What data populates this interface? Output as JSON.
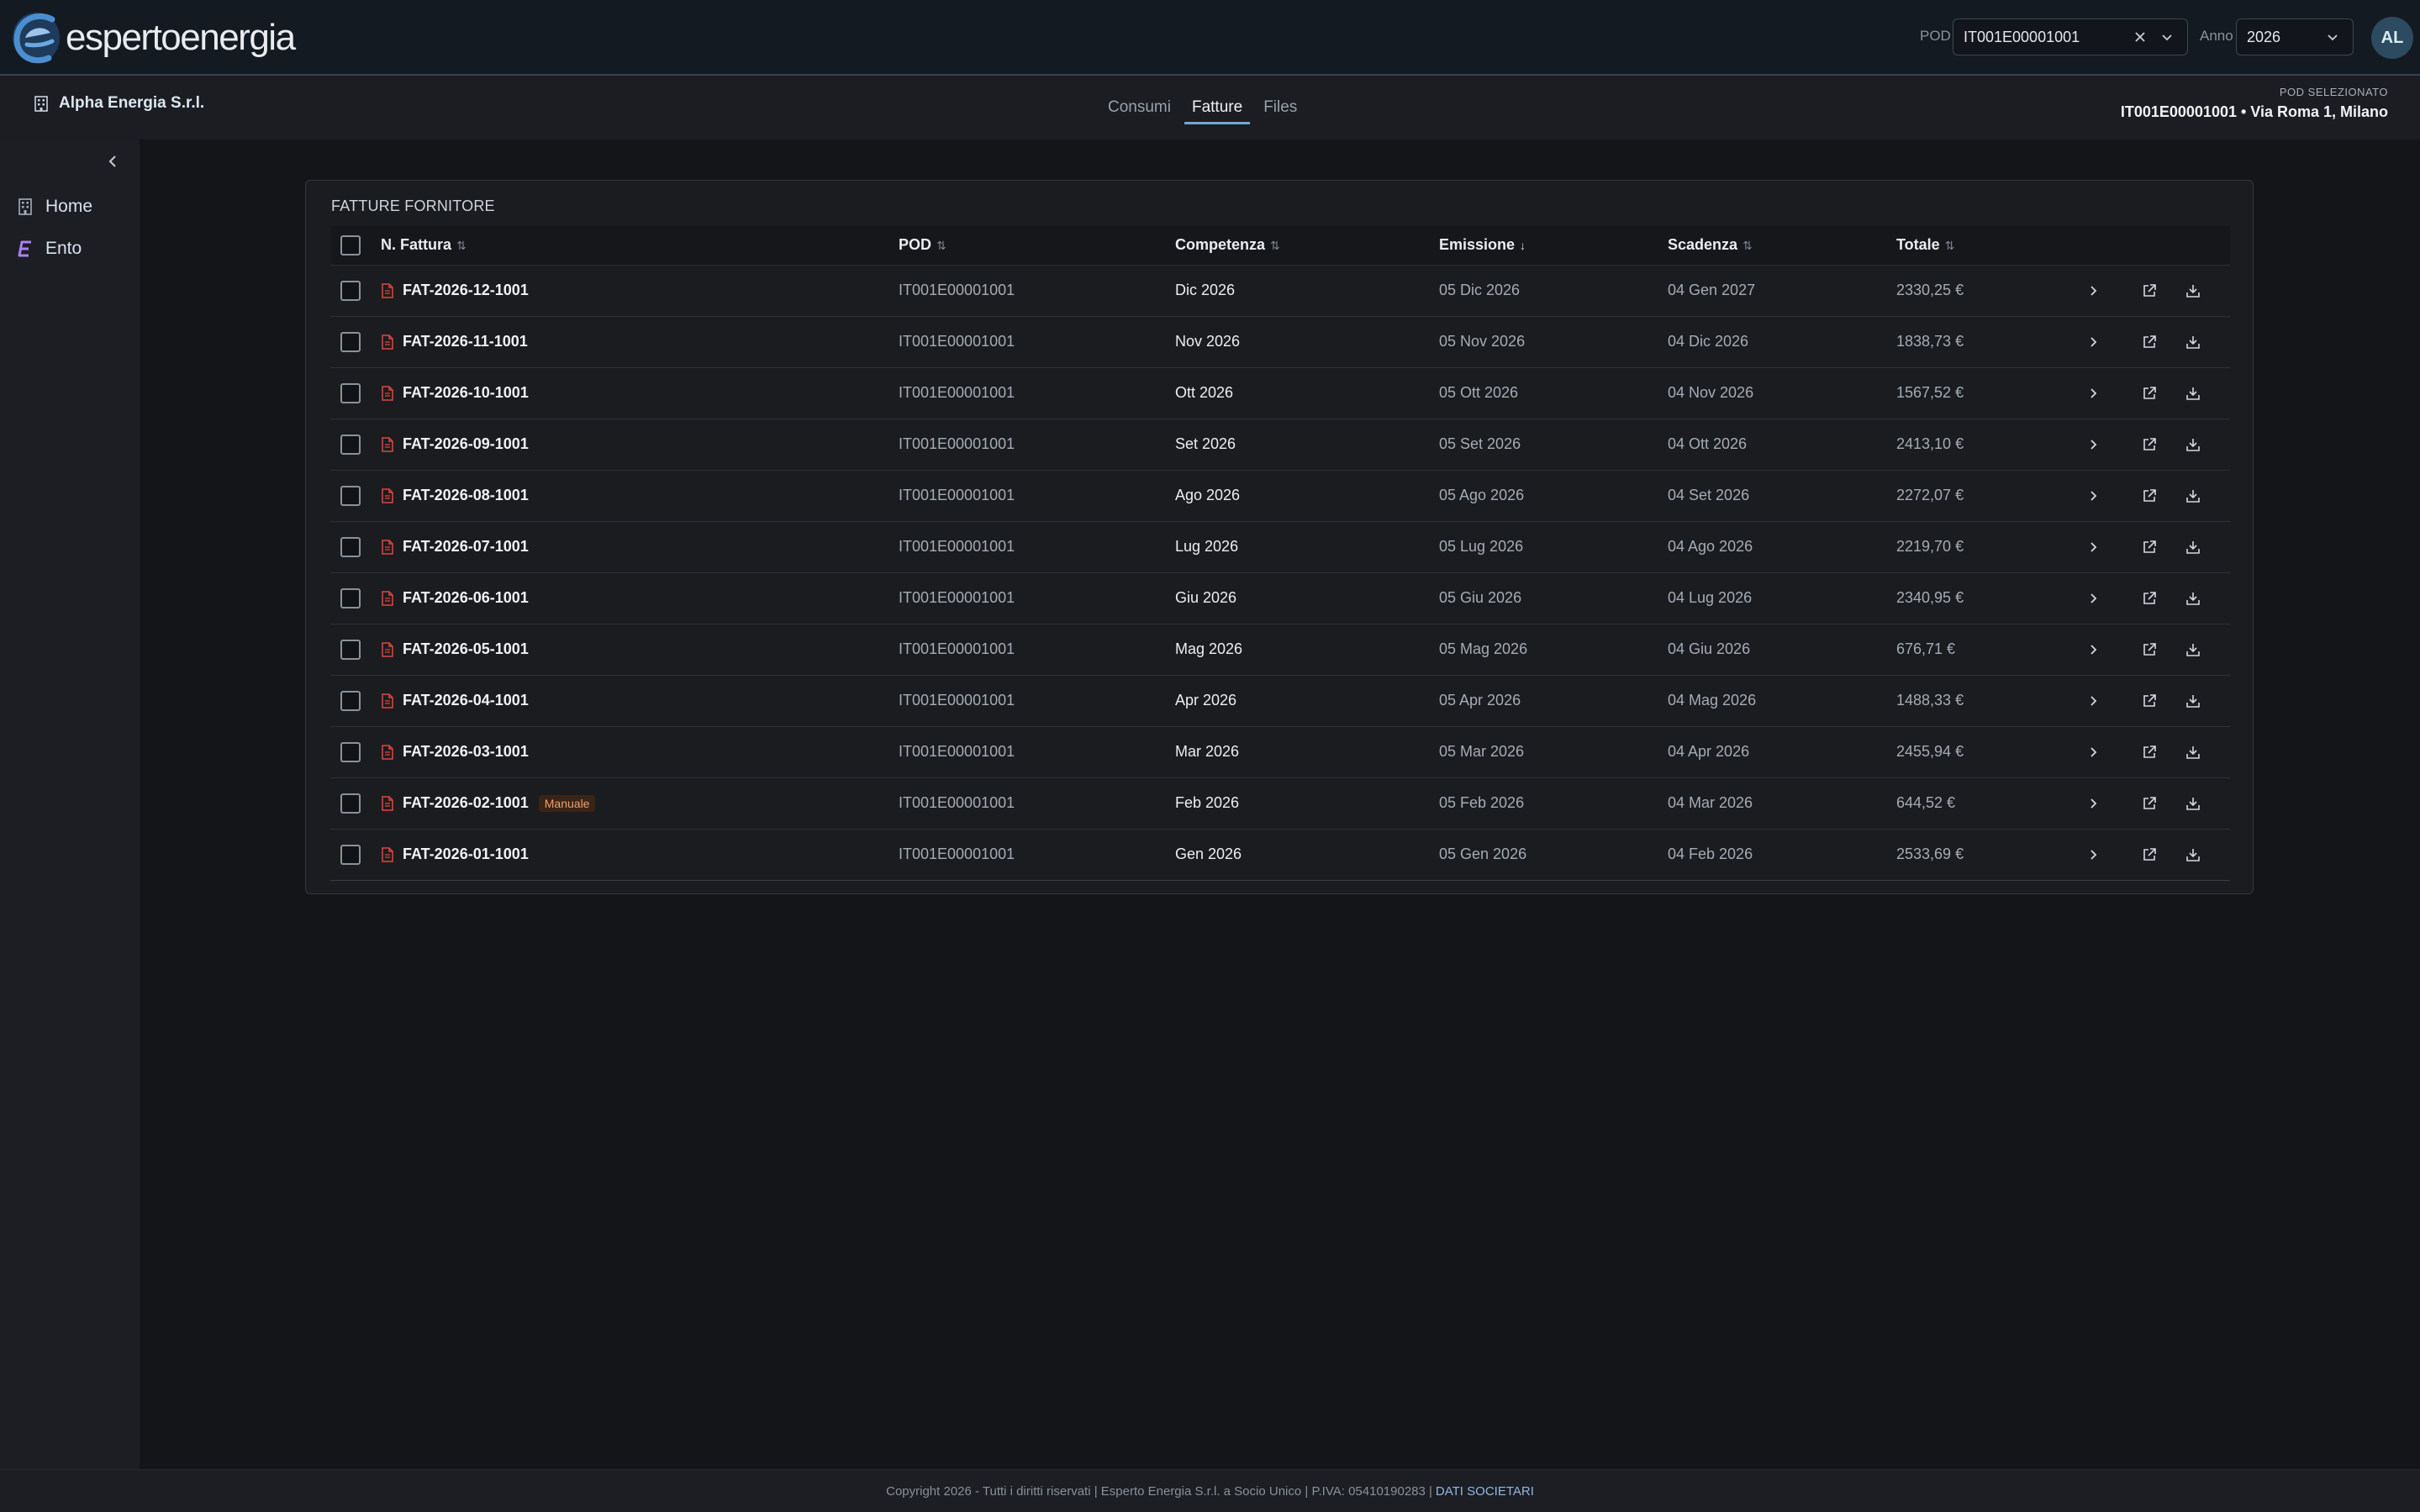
{
  "header": {
    "brand": "espertoenergia",
    "pod_label": "POD",
    "pod_value": "IT001E00001001",
    "year_label": "Anno",
    "year_value": "2026",
    "avatar_initials": "AL"
  },
  "subheader": {
    "company": "Alpha Energia S.r.l.",
    "tabs": [
      {
        "label": "Consumi",
        "active": false
      },
      {
        "label": "Fatture",
        "active": true
      },
      {
        "label": "Files",
        "active": false
      }
    ],
    "pod_selected_label": "POD SELEZIONATO",
    "pod_selected_value": "IT001E00001001 • Via Roma 1, Milano"
  },
  "sidebar": {
    "items": [
      {
        "label": "Home",
        "icon": "building-icon"
      },
      {
        "label": "Ento",
        "icon": "e-logo-icon"
      }
    ]
  },
  "card": {
    "title": "FATTURE FORNITORE",
    "columns": [
      {
        "label": "N. Fattura",
        "sort": "both"
      },
      {
        "label": "POD",
        "sort": "both"
      },
      {
        "label": "Competenza",
        "sort": "both"
      },
      {
        "label": "Emissione",
        "sort": "desc"
      },
      {
        "label": "Scadenza",
        "sort": "both"
      },
      {
        "label": "Totale",
        "sort": "both"
      }
    ],
    "rows": [
      {
        "n": "FAT-2026-12-1001",
        "badge": "",
        "pod": "IT001E00001001",
        "competenza": "Dic 2026",
        "emissione": "05 Dic 2026",
        "scadenza": "04 Gen 2027",
        "totale": "2330,25 €"
      },
      {
        "n": "FAT-2026-11-1001",
        "badge": "",
        "pod": "IT001E00001001",
        "competenza": "Nov 2026",
        "emissione": "05 Nov 2026",
        "scadenza": "04 Dic 2026",
        "totale": "1838,73 €"
      },
      {
        "n": "FAT-2026-10-1001",
        "badge": "",
        "pod": "IT001E00001001",
        "competenza": "Ott 2026",
        "emissione": "05 Ott 2026",
        "scadenza": "04 Nov 2026",
        "totale": "1567,52 €"
      },
      {
        "n": "FAT-2026-09-1001",
        "badge": "",
        "pod": "IT001E00001001",
        "competenza": "Set 2026",
        "emissione": "05 Set 2026",
        "scadenza": "04 Ott 2026",
        "totale": "2413,10 €"
      },
      {
        "n": "FAT-2026-08-1001",
        "badge": "",
        "pod": "IT001E00001001",
        "competenza": "Ago 2026",
        "emissione": "05 Ago 2026",
        "scadenza": "04 Set 2026",
        "totale": "2272,07 €"
      },
      {
        "n": "FAT-2026-07-1001",
        "badge": "",
        "pod": "IT001E00001001",
        "competenza": "Lug 2026",
        "emissione": "05 Lug 2026",
        "scadenza": "04 Ago 2026",
        "totale": "2219,70 €"
      },
      {
        "n": "FAT-2026-06-1001",
        "badge": "",
        "pod": "IT001E00001001",
        "competenza": "Giu 2026",
        "emissione": "05 Giu 2026",
        "scadenza": "04 Lug 2026",
        "totale": "2340,95 €"
      },
      {
        "n": "FAT-2026-05-1001",
        "badge": "",
        "pod": "IT001E00001001",
        "competenza": "Mag 2026",
        "emissione": "05 Mag 2026",
        "scadenza": "04 Giu 2026",
        "totale": "676,71 €"
      },
      {
        "n": "FAT-2026-04-1001",
        "badge": "",
        "pod": "IT001E00001001",
        "competenza": "Apr 2026",
        "emissione": "05 Apr 2026",
        "scadenza": "04 Mag 2026",
        "totale": "1488,33 €"
      },
      {
        "n": "FAT-2026-03-1001",
        "badge": "",
        "pod": "IT001E00001001",
        "competenza": "Mar 2026",
        "emissione": "05 Mar 2026",
        "scadenza": "04 Apr 2026",
        "totale": "2455,94 €"
      },
      {
        "n": "FAT-2026-02-1001",
        "badge": "Manuale",
        "pod": "IT001E00001001",
        "competenza": "Feb 2026",
        "emissione": "05 Feb 2026",
        "scadenza": "04 Mar 2026",
        "totale": "644,52 €"
      },
      {
        "n": "FAT-2026-01-1001",
        "badge": "",
        "pod": "IT001E00001001",
        "competenza": "Gen 2026",
        "emissione": "05 Gen 2026",
        "scadenza": "04 Feb 2026",
        "totale": "2533,69 €"
      }
    ]
  },
  "footer": {
    "text": "Copyright 2026 - Tutti i diritti riservati | Esperto Energia S.r.l. a Socio Unico | P.IVA: 05410190283 |",
    "link": "DATI SOCIETARI"
  },
  "colors": {
    "accent": "#6ea8d6",
    "pdf_icon": "#e0463c",
    "badge_text": "#f0a06c",
    "badge_bg": "#3a2416"
  }
}
